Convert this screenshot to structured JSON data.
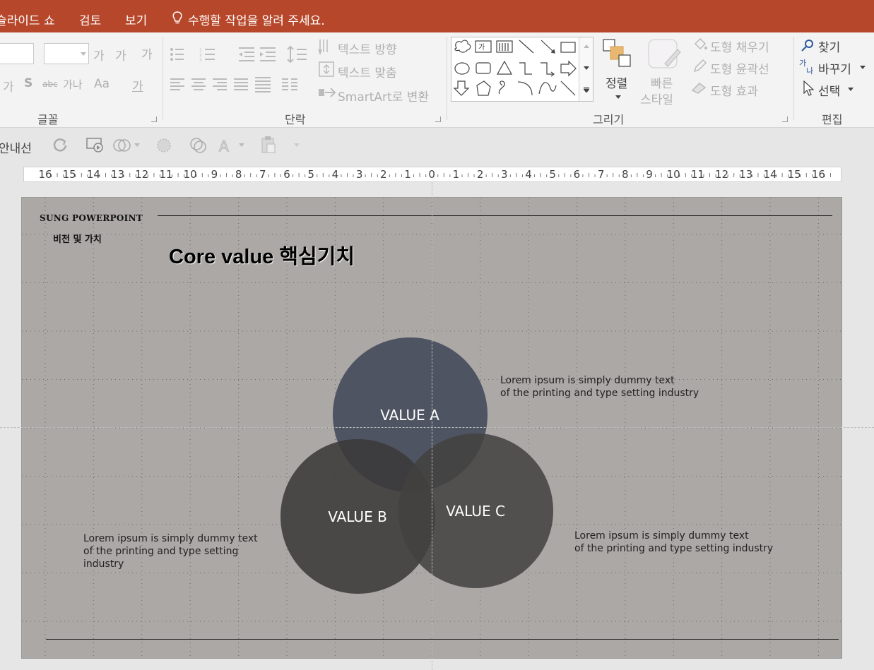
{
  "tabs": {
    "slideshow": "슬라이드 쇼",
    "review": "검토",
    "view": "보기",
    "tell_me": "수행할 작업을 알려 주세요."
  },
  "ribbon": {
    "font": {
      "group_label": "글꼴",
      "grow_font": "가",
      "shrink_font": "가",
      "clear_format": "가",
      "char_spacing": "가나",
      "change_case": "Aa",
      "font_color": "가",
      "char_preview": "가"
    },
    "paragraph": {
      "group_label": "단락",
      "text_direction": "텍스트 방향",
      "align_text": "텍스트 맞춤",
      "smartart": "SmartArt로 변환"
    },
    "drawing": {
      "group_label": "그리기",
      "arrange": "정렬",
      "quick_styles_1": "빠른",
      "quick_styles_2": "스타일",
      "shape_fill": "도형 채우기",
      "shape_outline": "도형 윤곽선",
      "shape_effects": "도형 효과"
    },
    "editing": {
      "group_label": "편집",
      "find": "찾기",
      "replace": "바꾸기",
      "select": "선택"
    }
  },
  "quick_toolbar": {
    "guides": "안내선"
  },
  "ruler": {
    "ticks": [
      "16",
      "15",
      "14",
      "13",
      "12",
      "11",
      "10",
      "9",
      "8",
      "7",
      "6",
      "5",
      "4",
      "3",
      "2",
      "1",
      "0",
      "1",
      "2",
      "3",
      "4",
      "5",
      "6",
      "7",
      "8",
      "9",
      "10",
      "11",
      "12",
      "13",
      "14",
      "15",
      "16"
    ]
  },
  "slide": {
    "brand": "SUNG POWERPOINT",
    "subtitle": "비전 및 가치",
    "title": "Core value 핵심기치",
    "value_a": "VALUE A",
    "value_b": "VALUE B",
    "value_c": "VALUE C",
    "text_a": "Lorem ipsum is simply dummy text\n of the printing and type setting industry",
    "text_b": "Lorem ipsum is simply dummy text\n of the printing and type setting\nindustry",
    "text_c": "Lorem ipsum is simply dummy text\nof the printing and type setting industry"
  },
  "colors": {
    "tab_bar": "#b7472a",
    "slide_bg": "#aba8a6",
    "circle_a": "#4a505e",
    "circle_b": "#464444",
    "circle_c": "#4e4d4c"
  }
}
